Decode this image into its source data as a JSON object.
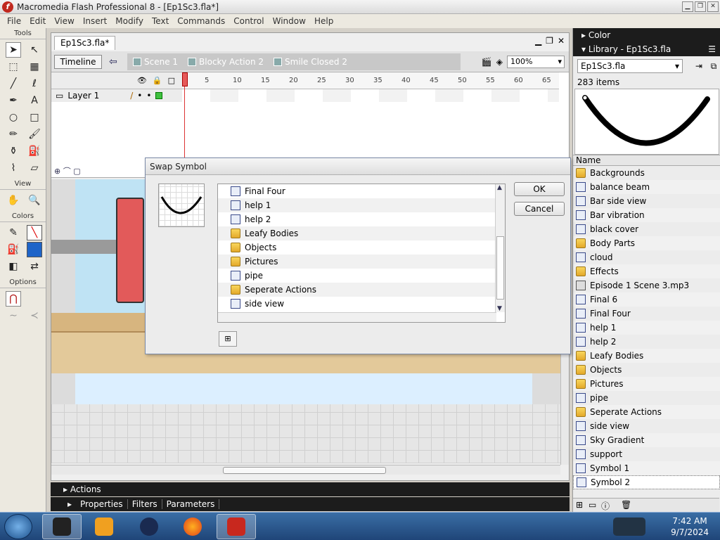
{
  "window": {
    "title": "Macromedia Flash Professional 8 - [Ep1Sc3.fla*]"
  },
  "menu": [
    "File",
    "Edit",
    "View",
    "Insert",
    "Modify",
    "Text",
    "Commands",
    "Control",
    "Window",
    "Help"
  ],
  "tools": {
    "header": "Tools",
    "view_header": "View",
    "colors_header": "Colors",
    "options_header": "Options"
  },
  "document": {
    "tab": "Ep1Sc3.fla*",
    "timeline_button": "Timeline",
    "breadcrumbs": [
      "Scene 1",
      "Blocky Action 2",
      "Smile Closed 2"
    ],
    "zoom": "100%"
  },
  "timeline": {
    "layer_name": "Layer 1",
    "ruler": [
      "5",
      "10",
      "15",
      "20",
      "25",
      "30",
      "35",
      "40",
      "45",
      "50",
      "55",
      "60",
      "65"
    ]
  },
  "panels": {
    "actions": "Actions",
    "properties": "Properties",
    "filters": "Filters",
    "parameters": "Parameters"
  },
  "right": {
    "color_title": "Color",
    "library_title": "Library - Ep1Sc3.fla",
    "library_doc": "Ep1Sc3.fla",
    "item_count": "283 items",
    "name_header": "Name",
    "items": [
      {
        "label": "Backgrounds",
        "type": "folder"
      },
      {
        "label": "balance beam",
        "type": "symbol"
      },
      {
        "label": "Bar side view",
        "type": "symbol"
      },
      {
        "label": "Bar vibration",
        "type": "symbol"
      },
      {
        "label": "black cover",
        "type": "symbol"
      },
      {
        "label": "Body Parts",
        "type": "folder"
      },
      {
        "label": "cloud",
        "type": "symbol"
      },
      {
        "label": "Effects",
        "type": "folder"
      },
      {
        "label": "Episode 1 Scene 3.mp3",
        "type": "sound"
      },
      {
        "label": "Final 6",
        "type": "symbol"
      },
      {
        "label": "Final Four",
        "type": "symbol"
      },
      {
        "label": "help 1",
        "type": "symbol"
      },
      {
        "label": "help 2",
        "type": "symbol"
      },
      {
        "label": "Leafy Bodies",
        "type": "folder"
      },
      {
        "label": "Objects",
        "type": "folder"
      },
      {
        "label": "Pictures",
        "type": "folder"
      },
      {
        "label": "pipe",
        "type": "symbol"
      },
      {
        "label": "Seperate Actions",
        "type": "folder"
      },
      {
        "label": "side view",
        "type": "symbol"
      },
      {
        "label": "Sky Gradient",
        "type": "symbol"
      },
      {
        "label": "support",
        "type": "symbol"
      },
      {
        "label": "Symbol 1",
        "type": "symbol"
      },
      {
        "label": "Symbol 2",
        "type": "symbol",
        "selected": true
      }
    ]
  },
  "dialog": {
    "title": "Swap Symbol",
    "ok": "OK",
    "cancel": "Cancel",
    "items": [
      {
        "label": "Final Four",
        "type": "symbol"
      },
      {
        "label": "help 1",
        "type": "symbol"
      },
      {
        "label": "help 2",
        "type": "symbol"
      },
      {
        "label": "Leafy Bodies",
        "type": "folder"
      },
      {
        "label": "Objects",
        "type": "folder"
      },
      {
        "label": "Pictures",
        "type": "folder"
      },
      {
        "label": "pipe",
        "type": "symbol"
      },
      {
        "label": "Seperate Actions",
        "type": "folder"
      },
      {
        "label": "side view",
        "type": "symbol"
      }
    ]
  },
  "taskbar": {
    "time": "7:42 AM",
    "date": "9/7/2024"
  }
}
